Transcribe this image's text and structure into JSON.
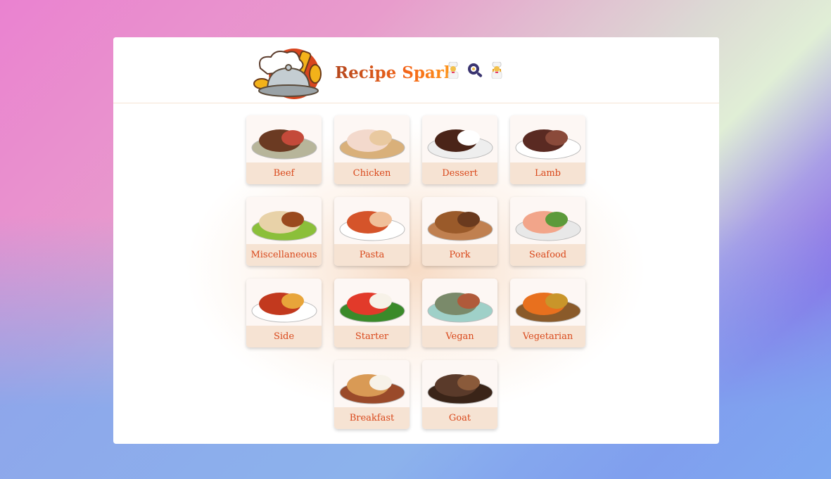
{
  "header": {
    "title": "Recipe Spark",
    "emojis": [
      "chef-man",
      "frying-pan",
      "chef-woman"
    ]
  },
  "categories": [
    {
      "label": "Beef",
      "colors": [
        "#6b3a22",
        "#c44a3a",
        "#b7b59a"
      ]
    },
    {
      "label": "Chicken",
      "colors": [
        "#f3d9cc",
        "#e9c9a0",
        "#d9b07a"
      ]
    },
    {
      "label": "Dessert",
      "colors": [
        "#4a2418",
        "#ffffff",
        "#eeeeee"
      ]
    },
    {
      "label": "Lamb",
      "colors": [
        "#5a2a22",
        "#8a4a3a",
        "#ffffff"
      ]
    },
    {
      "label": "Miscellaneous",
      "colors": [
        "#e8d2a8",
        "#9a4a1e",
        "#8bbf3a"
      ]
    },
    {
      "label": "Pasta",
      "colors": [
        "#d5542a",
        "#f0c09a",
        "#ffffff"
      ]
    },
    {
      "label": "Pork",
      "colors": [
        "#9a5a2a",
        "#6a3a1e",
        "#c08050"
      ]
    },
    {
      "label": "Seafood",
      "colors": [
        "#f2a58a",
        "#5c9a3a",
        "#e8e8e8"
      ]
    },
    {
      "label": "Side",
      "colors": [
        "#c2391e",
        "#e8a53a",
        "#ffffff"
      ]
    },
    {
      "label": "Starter",
      "colors": [
        "#e23a2a",
        "#f7f2e8",
        "#3a8a2a"
      ]
    },
    {
      "label": "Vegan",
      "colors": [
        "#7a8a6a",
        "#b05a3a",
        "#9fd0c8"
      ]
    },
    {
      "label": "Vegetarian",
      "colors": [
        "#e8701e",
        "#c9952a",
        "#8a5a2a"
      ]
    },
    {
      "label": "Breakfast",
      "colors": [
        "#d99a55",
        "#f7f2e8",
        "#9a4a2a"
      ]
    },
    {
      "label": "Goat",
      "colors": [
        "#5a3a2a",
        "#8a5a3a",
        "#3a2418"
      ]
    }
  ]
}
